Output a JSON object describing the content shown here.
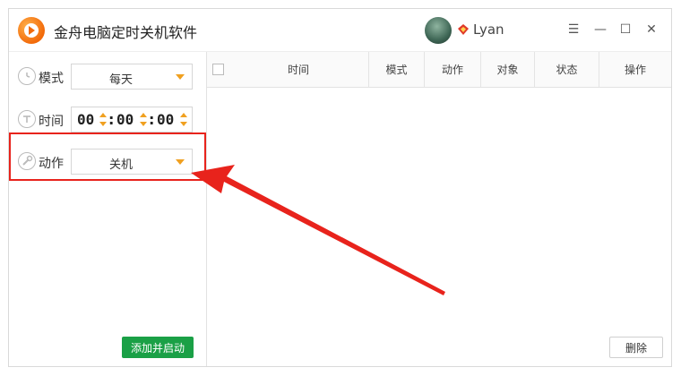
{
  "app": {
    "title": "金舟电脑定时关机软件"
  },
  "user": {
    "name": "Lyan"
  },
  "window_controls": {
    "menu": "☰",
    "minimize": "—",
    "maximize": "☐",
    "close": "✕"
  },
  "form": {
    "mode": {
      "label": "模式",
      "value": "每天"
    },
    "time": {
      "label": "时间",
      "hours": "00",
      "minutes": "00",
      "seconds": "00",
      "separator": ":"
    },
    "action": {
      "label": "动作",
      "value": "关机"
    },
    "add_button": "添加并启动"
  },
  "table": {
    "columns": [
      "时间",
      "模式",
      "动作",
      "对象",
      "状态",
      "操作"
    ],
    "rows": []
  },
  "delete_button": "删除",
  "colors": {
    "accent_orange": "#f0a020",
    "primary_green": "#1aa046",
    "annotation_red": "#e8231c"
  }
}
